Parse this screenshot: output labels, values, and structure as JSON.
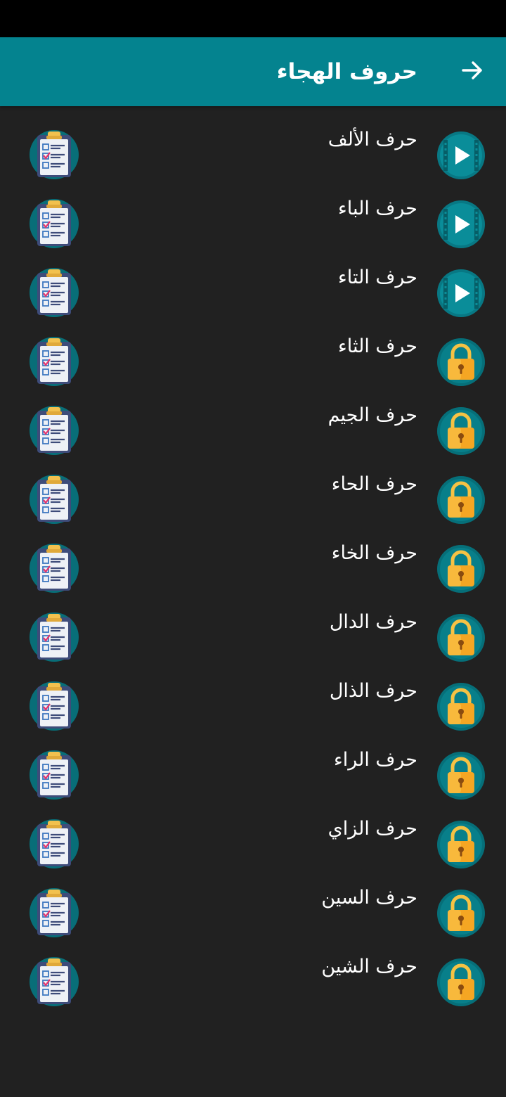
{
  "app_bar": {
    "title": "حروف الهجاء",
    "back_icon": "arrow-right-icon",
    "color": "#04838f"
  },
  "background_color": "#212121",
  "letters": [
    {
      "label": "حرف الألف",
      "status": "unlocked",
      "status_icon": "play-video-icon",
      "quiz_icon": "clipboard-quiz-icon"
    },
    {
      "label": "حرف الباء",
      "status": "unlocked",
      "status_icon": "play-video-icon",
      "quiz_icon": "clipboard-quiz-icon"
    },
    {
      "label": "حرف التاء",
      "status": "unlocked",
      "status_icon": "play-video-icon",
      "quiz_icon": "clipboard-quiz-icon"
    },
    {
      "label": "حرف الثاء",
      "status": "locked",
      "status_icon": "padlock-icon",
      "quiz_icon": "clipboard-quiz-icon"
    },
    {
      "label": "حرف الجيم",
      "status": "locked",
      "status_icon": "padlock-icon",
      "quiz_icon": "clipboard-quiz-icon"
    },
    {
      "label": "حرف الحاء",
      "status": "locked",
      "status_icon": "padlock-icon",
      "quiz_icon": "clipboard-quiz-icon"
    },
    {
      "label": "حرف الخاء",
      "status": "locked",
      "status_icon": "padlock-icon",
      "quiz_icon": "clipboard-quiz-icon"
    },
    {
      "label": "حرف الدال",
      "status": "locked",
      "status_icon": "padlock-icon",
      "quiz_icon": "clipboard-quiz-icon"
    },
    {
      "label": "حرف الذال",
      "status": "locked",
      "status_icon": "padlock-icon",
      "quiz_icon": "clipboard-quiz-icon"
    },
    {
      "label": "حرف الراء",
      "status": "locked",
      "status_icon": "padlock-icon",
      "quiz_icon": "clipboard-quiz-icon"
    },
    {
      "label": "حرف الزاي",
      "status": "locked",
      "status_icon": "padlock-icon",
      "quiz_icon": "clipboard-quiz-icon"
    },
    {
      "label": "حرف السين",
      "status": "locked",
      "status_icon": "padlock-icon",
      "quiz_icon": "clipboard-quiz-icon"
    },
    {
      "label": "حرف الشين",
      "status": "locked",
      "status_icon": "padlock-icon",
      "quiz_icon": "clipboard-quiz-icon"
    }
  ]
}
